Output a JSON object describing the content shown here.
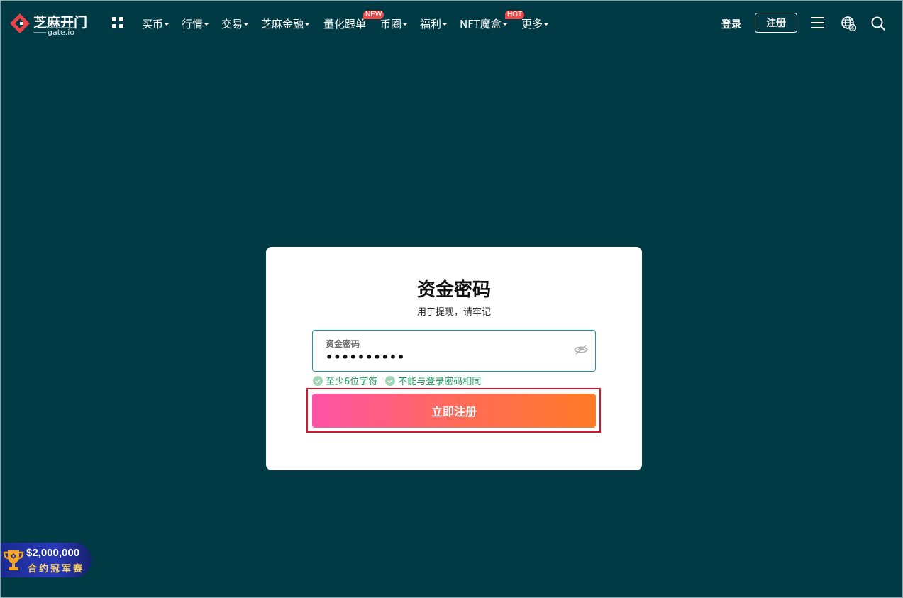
{
  "header": {
    "logo_cn": "芝麻开门",
    "logo_en": "gate.io",
    "nav": [
      {
        "label": "买币",
        "has_caret": true,
        "badge": ""
      },
      {
        "label": "行情",
        "has_caret": true,
        "badge": ""
      },
      {
        "label": "交易",
        "has_caret": true,
        "badge": ""
      },
      {
        "label": "芝麻金融",
        "has_caret": true,
        "badge": ""
      },
      {
        "label": "量化跟单",
        "has_caret": false,
        "badge": "NEW"
      },
      {
        "label": "币圈",
        "has_caret": true,
        "badge": ""
      },
      {
        "label": "福利",
        "has_caret": true,
        "badge": ""
      },
      {
        "label": "NFT魔盒",
        "has_caret": true,
        "badge": "HOT"
      },
      {
        "label": "更多",
        "has_caret": true,
        "badge": ""
      }
    ],
    "login_label": "登录",
    "register_label": "注册",
    "icons": [
      "apps-grid-icon",
      "menu-icon",
      "globe-currency-icon",
      "search-icon"
    ]
  },
  "modal": {
    "title": "资金密码",
    "subtitle": "用于提现，请牢记",
    "field_label": "资金密码",
    "field_value": "••••••••••",
    "hints": [
      {
        "text": "至少6位字符",
        "icon": "check-icon"
      },
      {
        "text": "不能与登录密码相同",
        "icon": "check-icon"
      }
    ],
    "submit_label": "立即注册"
  },
  "promo": {
    "amount": "$2,000,000",
    "label": "合约冠军赛",
    "icon": "trophy-icon"
  },
  "colors": {
    "background": "#003a45",
    "accent": "#1a9aa3",
    "success": "#1a9a5c",
    "button_gradient_start": "#ff52a8",
    "button_gradient_end": "#ff7a26",
    "highlight": "#d3162f",
    "badge": "#e94b4b"
  }
}
